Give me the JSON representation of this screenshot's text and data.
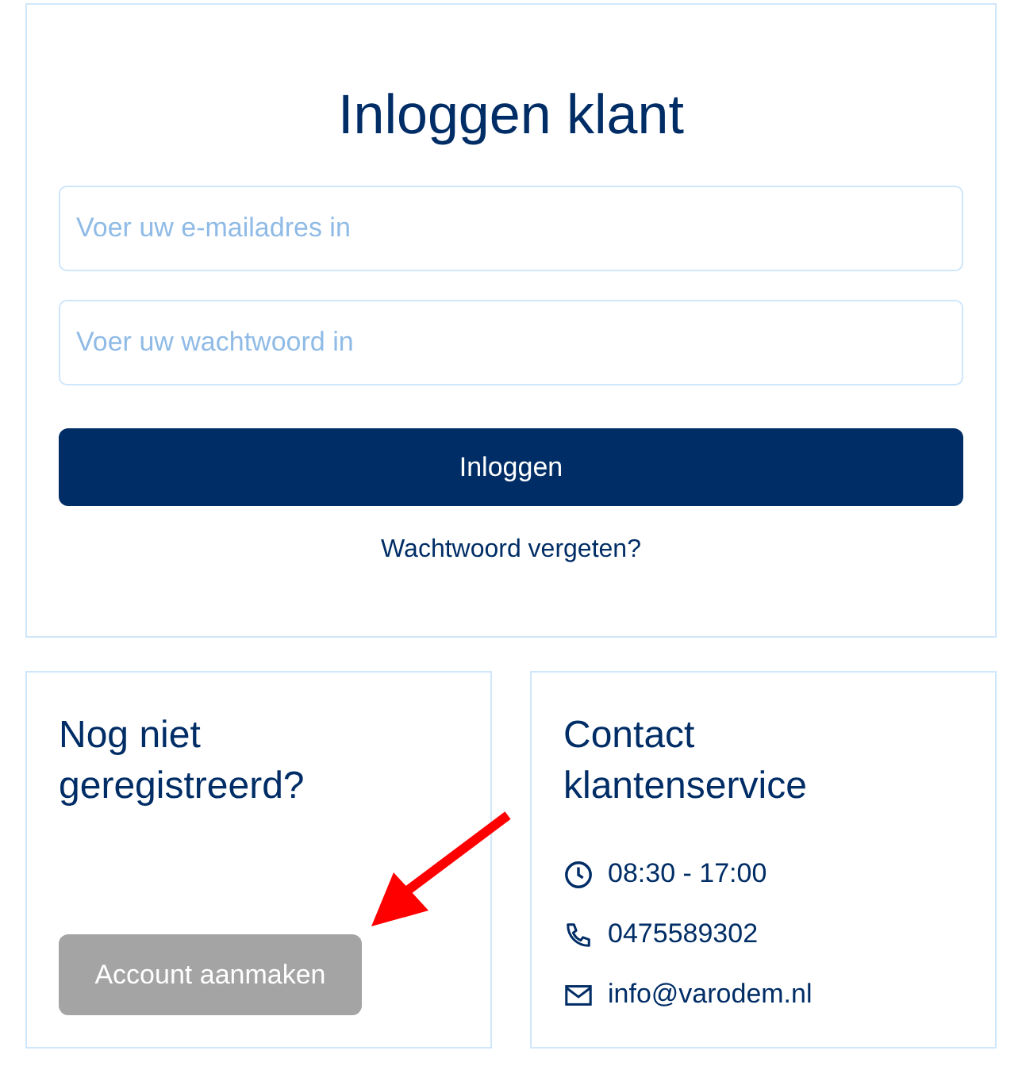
{
  "login": {
    "title": "Inloggen klant",
    "email": {
      "placeholder": "Voer uw e-mailadres in"
    },
    "password": {
      "placeholder": "Voer uw wachtwoord in"
    },
    "submit": "Inloggen",
    "forgot_link": "Wachtwoord vergeten?"
  },
  "register": {
    "title": "Nog niet geregistreerd?",
    "button": "Account aanmaken"
  },
  "contact": {
    "title": "Contact klantenservice",
    "items": [
      {
        "kind": "hours",
        "text": "08:30 - 17:00"
      },
      {
        "kind": "phone",
        "text": "0475589302"
      },
      {
        "kind": "email",
        "text": "info@varodem.nl"
      }
    ]
  }
}
